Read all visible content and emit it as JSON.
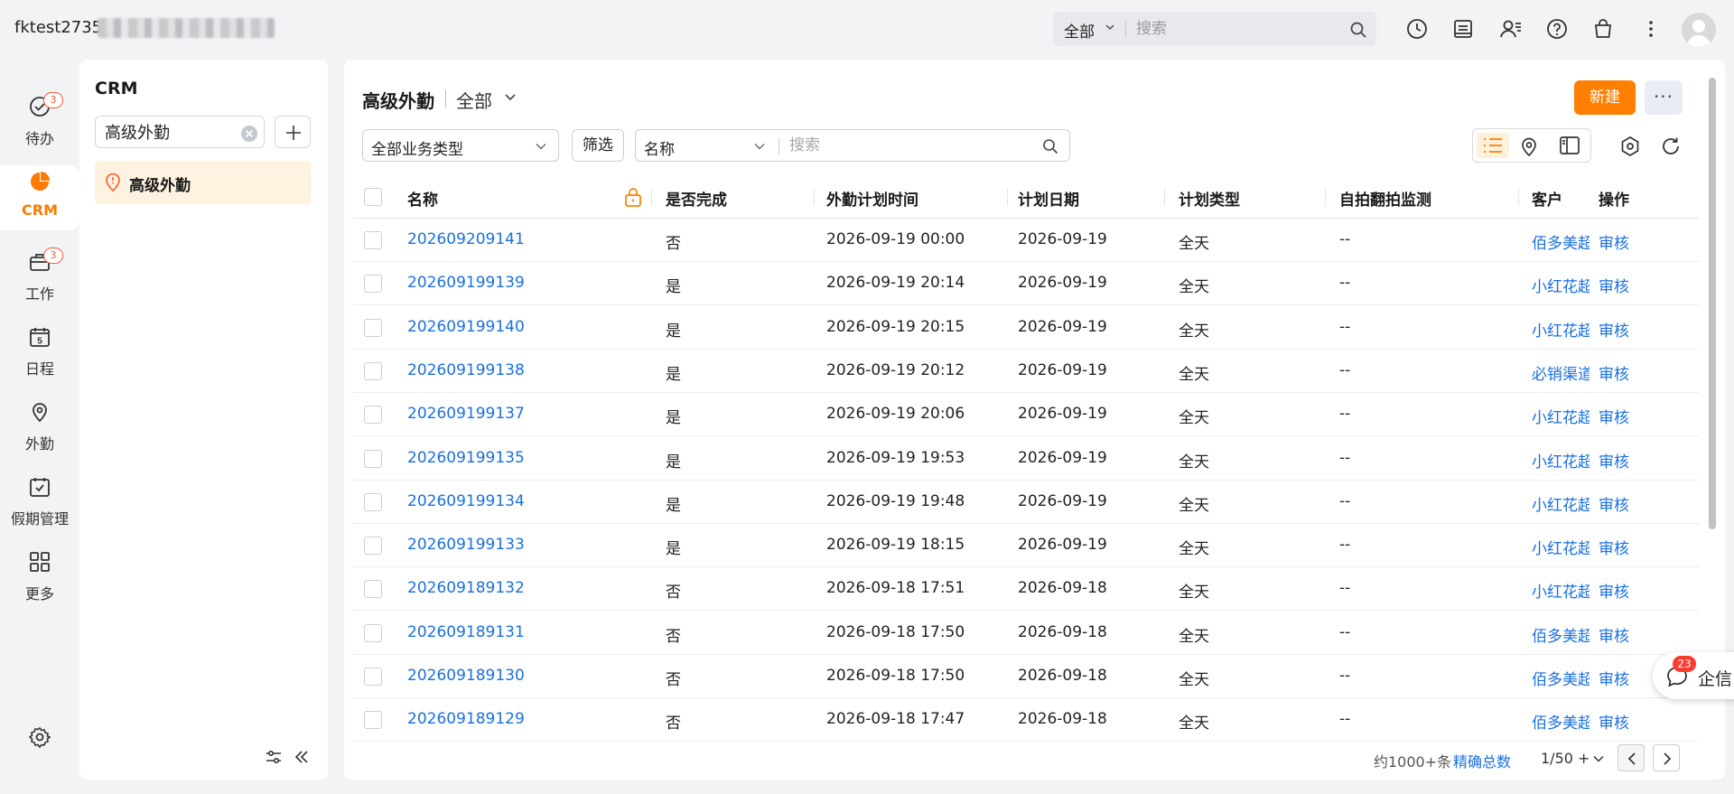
{
  "topbar": {
    "account": "fktest2735_",
    "search_scope": "全部",
    "search_placeholder": "搜索"
  },
  "nav": {
    "items": [
      {
        "label": "待办",
        "badge": "3"
      },
      {
        "label": "CRM"
      },
      {
        "label": "工作",
        "badge": "3"
      },
      {
        "label": "日程",
        "calendar_day": "5"
      },
      {
        "label": "外勤"
      },
      {
        "label": "假期管理"
      },
      {
        "label": "更多"
      }
    ]
  },
  "sidebar": {
    "title": "CRM",
    "search_value": "高级外勤",
    "active_item": "高级外勤"
  },
  "main": {
    "title": "高级外勤",
    "scope": "全部",
    "new_button": "新建",
    "more_button": "···",
    "filter_type": "全部业务类型",
    "filter_button": "筛选",
    "search_field": "名称",
    "search_placeholder": "搜索"
  },
  "table": {
    "columns": [
      "名称",
      "是否完成",
      "外勤计划时间",
      "计划日期",
      "计划类型",
      "自拍翻拍监测",
      "客户",
      "操作"
    ],
    "rows": [
      {
        "name": "202609209141",
        "done": "否",
        "plan_time": "2026-09-19 00:00",
        "plan_date": "2026-09-19",
        "plan_type": "全天",
        "selfie": "--",
        "customer": "佰多美超市",
        "action": "审核"
      },
      {
        "name": "202609199139",
        "done": "是",
        "plan_time": "2026-09-19 20:14",
        "plan_date": "2026-09-19",
        "plan_type": "全天",
        "selfie": "--",
        "customer": "小红花超市",
        "action": "审核"
      },
      {
        "name": "202609199140",
        "done": "是",
        "plan_time": "2026-09-19 20:15",
        "plan_date": "2026-09-19",
        "plan_type": "全天",
        "selfie": "--",
        "customer": "小红花超市",
        "action": "审核"
      },
      {
        "name": "202609199138",
        "done": "是",
        "plan_time": "2026-09-19 20:12",
        "plan_date": "2026-09-19",
        "plan_type": "全天",
        "selfie": "--",
        "customer": "必销渠道",
        "action": "审核"
      },
      {
        "name": "202609199137",
        "done": "是",
        "plan_time": "2026-09-19 20:06",
        "plan_date": "2026-09-19",
        "plan_type": "全天",
        "selfie": "--",
        "customer": "小红花超市",
        "action": "审核"
      },
      {
        "name": "202609199135",
        "done": "是",
        "plan_time": "2026-09-19 19:53",
        "plan_date": "2026-09-19",
        "plan_type": "全天",
        "selfie": "--",
        "customer": "小红花超市",
        "action": "审核"
      },
      {
        "name": "202609199134",
        "done": "是",
        "plan_time": "2026-09-19 19:48",
        "plan_date": "2026-09-19",
        "plan_type": "全天",
        "selfie": "--",
        "customer": "小红花超市",
        "action": "审核"
      },
      {
        "name": "202609199133",
        "done": "是",
        "plan_time": "2026-09-19 18:15",
        "plan_date": "2026-09-19",
        "plan_type": "全天",
        "selfie": "--",
        "customer": "小红花超市",
        "action": "审核"
      },
      {
        "name": "202609189132",
        "done": "否",
        "plan_time": "2026-09-18 17:51",
        "plan_date": "2026-09-18",
        "plan_type": "全天",
        "selfie": "--",
        "customer": "小红花超市",
        "action": "审核"
      },
      {
        "name": "202609189131",
        "done": "否",
        "plan_time": "2026-09-18 17:50",
        "plan_date": "2026-09-18",
        "plan_type": "全天",
        "selfie": "--",
        "customer": "佰多美超市",
        "action": "审核"
      },
      {
        "name": "202609189130",
        "done": "否",
        "plan_time": "2026-09-18 17:50",
        "plan_date": "2026-09-18",
        "plan_type": "全天",
        "selfie": "--",
        "customer": "佰多美超市",
        "action": "审核"
      },
      {
        "name": "202609189129",
        "done": "否",
        "plan_time": "2026-09-18 17:47",
        "plan_date": "2026-09-18",
        "plan_type": "全天",
        "selfie": "--",
        "customer": "佰多美超市",
        "action": "审核"
      }
    ]
  },
  "pager": {
    "total": "约1000+条",
    "exact": "精确总数",
    "page": "1/50 +"
  },
  "chat": {
    "badge": "23",
    "label": "企信"
  },
  "colors": {
    "accent": "#ff8000",
    "link": "#1a6fe0",
    "badge": "#ff3b30"
  }
}
